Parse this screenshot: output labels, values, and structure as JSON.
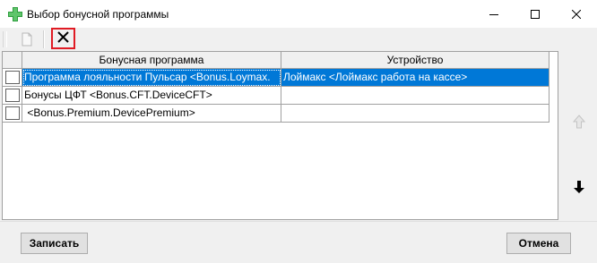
{
  "window": {
    "title": "Выбор бонусной программы",
    "icon": "green-cross-plus-icon",
    "controls": [
      "minimize-icon",
      "maximize-icon",
      "close-icon"
    ]
  },
  "toolbar": {
    "items": [
      {
        "icon": "new-document-icon",
        "enabled": false
      },
      {
        "icon": "delete-x-icon",
        "enabled": true,
        "highlighted": true,
        "highlight_color": "#e01b24"
      }
    ]
  },
  "grid": {
    "columns": [
      "Бонусная программа",
      "Устройство"
    ],
    "rows": [
      {
        "program": "Программа лояльности Пульсар <Bonus.Loymax.",
        "device": "Лоймакс <Лоймакс работа на кассе>",
        "selected": true
      },
      {
        "program": "Бонусы ЦФТ <Bonus.CFT.DeviceCFT>",
        "device": "",
        "selected": false
      },
      {
        "program": " <Bonus.Premium.DevicePremium>",
        "device": "",
        "selected": false
      }
    ],
    "selection_color": "#0078d7"
  },
  "side_buttons": {
    "up": {
      "icon": "arrow-up-icon",
      "enabled": false
    },
    "down": {
      "icon": "arrow-down-icon",
      "enabled": true
    }
  },
  "footer": {
    "save_label": "Записать",
    "cancel_label": "Отмена"
  }
}
